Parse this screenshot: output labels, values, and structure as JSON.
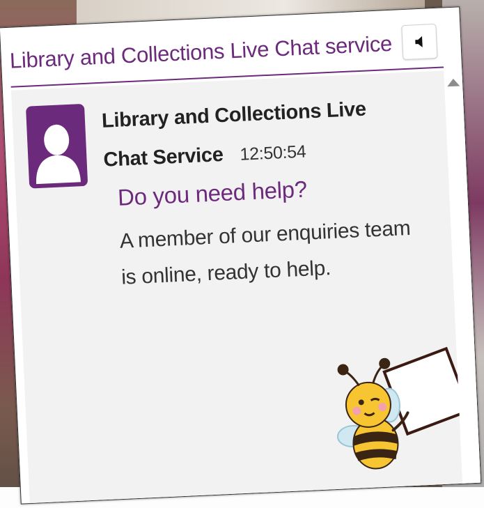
{
  "widget": {
    "title": "Library and Collections Live Chat service",
    "mute_icon": "speaker-icon",
    "accent_color": "#6c2a7c"
  },
  "message": {
    "sender": "Library and Collections Live Chat Service",
    "time": "12:50:54",
    "heading": "Do you need help?",
    "body": "A member of our enquiries team is online, ready to help.",
    "avatar_icon": "user-avatar-icon",
    "illustration_icon": "bee-holding-sign-icon"
  },
  "scrollbar": {
    "up_icon": "scroll-up-arrow-icon"
  }
}
